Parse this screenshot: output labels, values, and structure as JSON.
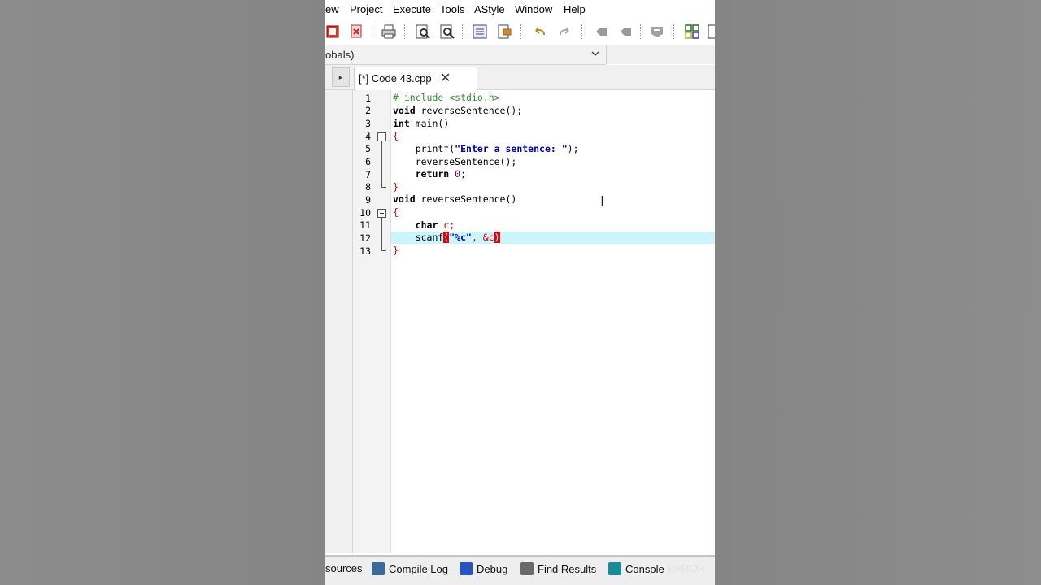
{
  "menu": {
    "items": [
      "ew",
      "Project",
      "Execute",
      "Tools",
      "AStyle",
      "Window",
      "Help"
    ]
  },
  "scope": {
    "selected": "obals)"
  },
  "editor": {
    "tab_label": "[*] Code 43.cpp",
    "tab_close": "✕",
    "line_numbers": [
      "1",
      "2",
      "3",
      "4",
      "5",
      "6",
      "7",
      "8",
      "9",
      "10",
      "11",
      "12",
      "13"
    ],
    "code": {
      "l1": "# include <stdio.h>",
      "l2_kw": "void",
      "l2_rest": " reverseSentence();",
      "l3_kw": "int",
      "l3_rest": " main()",
      "l4": "{",
      "l5_a": "    printf(",
      "l5_str": "\"Enter a sentence: \"",
      "l5_b": ");",
      "l6": "    reverseSentence();",
      "l7_kw": "    return",
      "l7_num": " 0",
      "l7_b": ";",
      "l8": "}",
      "l9_kw": "void",
      "l9_rest": " reverseSentence()",
      "l10": "{",
      "l11_kw": "    char",
      "l11_rest": " c;",
      "l12_a": "    scanf",
      "l12_open": "(",
      "l12_str": "\"%c\"",
      "l12_b": ", &c",
      "l12_close": ")",
      "l13": "}"
    },
    "highlight_color": "#ccf4fb",
    "bracket_match_color": "#e8000b"
  },
  "bottom_tabs": [
    "sources",
    "Compile Log",
    "Debug",
    "Find Results",
    "Console"
  ],
  "watermark": "ERROR"
}
